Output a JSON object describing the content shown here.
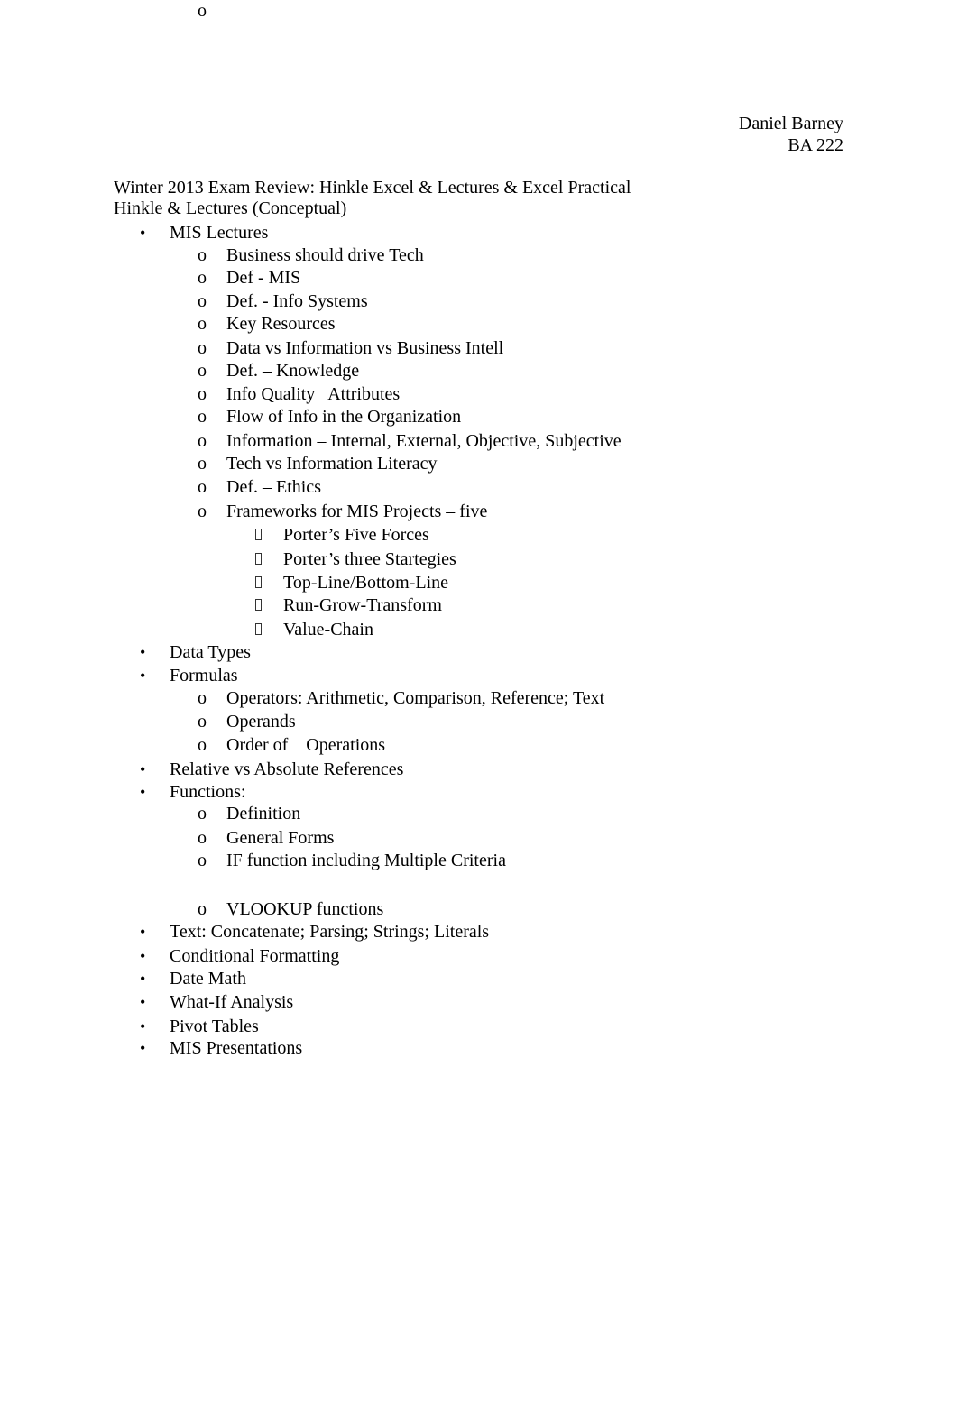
{
  "header": {
    "author": "Daniel Barney",
    "course": "BA 222"
  },
  "title": "Winter 2013 Exam Review: Hinkle Excel & Lectures & Excel Practical",
  "subtitle": "Hinkle & Lectures (Conceptual)",
  "markers": {
    "level1": "•",
    "level2": "o",
    "level3": "square-glyph"
  },
  "outline": [
    {
      "label": "MIS Lectures",
      "children": [
        {
          "label": "Business should drive Tech"
        },
        {
          "label": "Def - MIS"
        },
        {
          "label": "Def. - Info Systems"
        },
        {
          "label": "Key Resources"
        },
        {
          "label": "Data vs Information vs Business Intell"
        },
        {
          "label": "Def. – Knowledge"
        },
        {
          "label": "Info Quality   Attributes"
        },
        {
          "label": "Flow of Info in the Organization"
        },
        {
          "label": "Information – Internal, External, Objective, Subjective"
        },
        {
          "label": "Tech vs Information Literacy"
        },
        {
          "label": "Def. – Ethics"
        },
        {
          "label": "Frameworks for MIS Projects – five",
          "children": [
            {
              "label": "Porter’s Five Forces"
            },
            {
              "label": "Porter’s three Startegies"
            },
            {
              "label": "Top-Line/Bottom-Line"
            },
            {
              "label": "Run-Grow-Transform"
            },
            {
              "label": "Value-Chain"
            }
          ]
        }
      ]
    },
    {
      "label": "Data Types"
    },
    {
      "label": "Formulas",
      "children": [
        {
          "label": "Operators: Arithmetic, Comparison, Reference; Text"
        },
        {
          "label": "Operands"
        },
        {
          "label": "Order of    Operations"
        }
      ]
    },
    {
      "label": "Relative vs Absolute References"
    },
    {
      "label": "Functions:",
      "children": [
        {
          "label": "Definition"
        },
        {
          "label": "General Forms"
        },
        {
          "label": "IF function including Multiple Criteria"
        },
        {
          "label": "VLOOKUP functions"
        }
      ]
    },
    {
      "label": "Text: Concatenate; Parsing; Strings; Literals"
    },
    {
      "label": "Conditional Formatting"
    },
    {
      "label": "Date Math"
    },
    {
      "label": "What-If Analysis"
    },
    {
      "label": "Pivot Tables"
    },
    {
      "label": "MIS Presentations",
      "children": [
        {
          "label": ""
        }
      ]
    }
  ]
}
